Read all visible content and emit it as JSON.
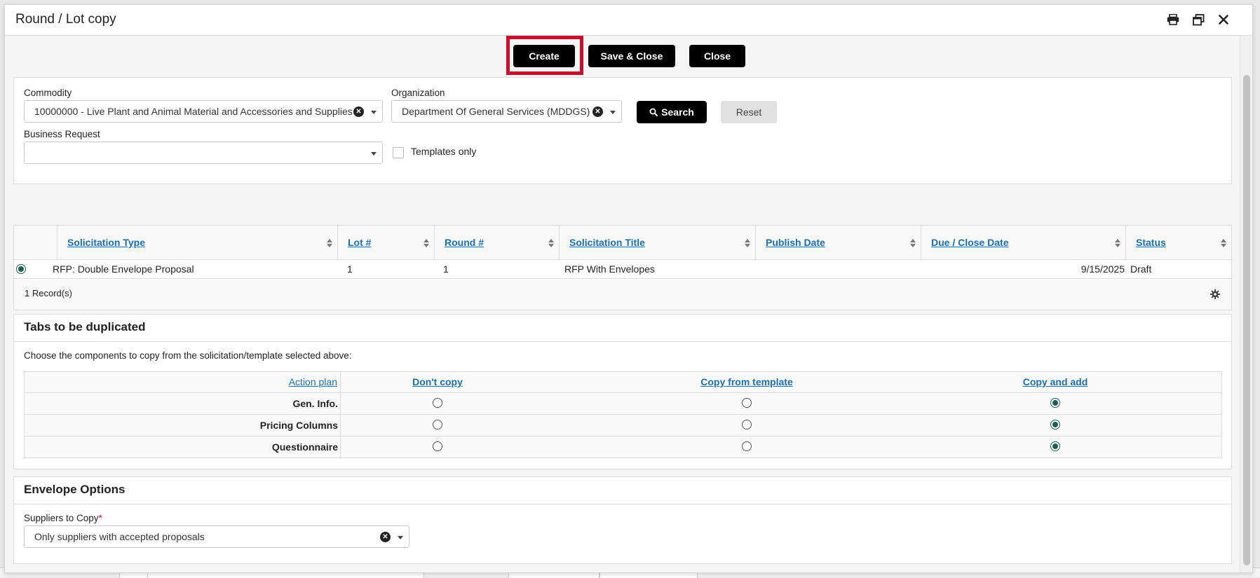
{
  "modal": {
    "title": "Round / Lot copy"
  },
  "actions": {
    "create": "Create",
    "save_close": "Save & Close",
    "close": "Close"
  },
  "filters": {
    "commodity_label": "Commodity",
    "commodity_value": "10000000 - Live Plant and Animal Material and Accessories and Supplies",
    "organization_label": "Organization",
    "organization_value": "Department Of General Services (MDDGS)",
    "search": "Search",
    "reset": "Reset",
    "business_request_label": "Business Request",
    "business_request_value": "",
    "templates_only": "Templates only"
  },
  "grid": {
    "columns": [
      "Solicitation Type",
      "Lot #",
      "Round #",
      "Solicitation Title",
      "Publish Date",
      "Due / Close Date",
      "Status"
    ],
    "rows": [
      {
        "solicitation_type": "RFP: Double Envelope Proposal",
        "lot": "1",
        "round": "1",
        "title": "RFP With Envelopes",
        "publish_date": "",
        "due_close_date": "9/15/2025",
        "status": "Draft"
      }
    ],
    "records": "1 Record(s)"
  },
  "tabs_dup": {
    "title": "Tabs to be duplicated",
    "description": "Choose the components to copy from the solicitation/template selected above:",
    "action_plan": "Action plan",
    "options": [
      "Don't copy",
      "Copy from template",
      "Copy and add"
    ],
    "rows": [
      {
        "label": "Gen. Info.",
        "selected": 2
      },
      {
        "label": "Pricing Columns",
        "selected": 2
      },
      {
        "label": "Questionnaire",
        "selected": 2
      }
    ]
  },
  "envelope": {
    "title": "Envelope Options",
    "suppliers_label": "Suppliers to Copy",
    "required_mark": "*",
    "suppliers_value": "Only suppliers with accepted proposals"
  },
  "colors": {
    "accent_red": "#c8102e",
    "link_blue": "#1a6fb5",
    "radio_selected": "#1d5e52"
  }
}
